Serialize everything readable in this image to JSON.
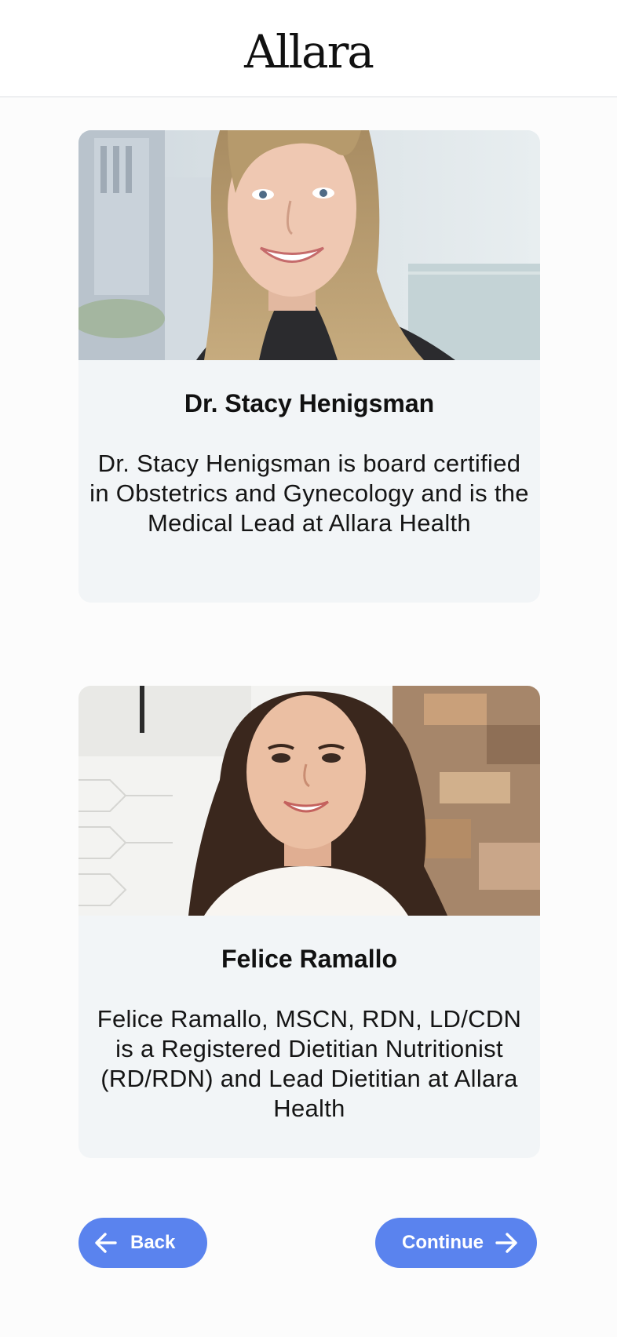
{
  "header": {
    "logo_text": "Allara"
  },
  "team": [
    {
      "name": "Dr. Stacy Henigsman",
      "description": "Dr. Stacy Henigsman is board certified in Obstetrics and Gynecology and is the Medical Lead at Allara Health",
      "photo_icon": "person-photo"
    },
    {
      "name": "Felice Ramallo",
      "description": "Felice Ramallo, MSCN, RDN, LD/CDN is a Registered Dietitian Nutritionist (RD/RDN) and Lead Dietitian at Allara Health",
      "photo_icon": "person-photo"
    }
  ],
  "nav": {
    "back_label": "Back",
    "continue_label": "Continue",
    "back_icon": "arrow-left-icon",
    "continue_icon": "arrow-right-icon"
  },
  "colors": {
    "button": "#5a83ee",
    "card_bg": "#f2f5f7",
    "page_bg": "#fcfcfc"
  }
}
